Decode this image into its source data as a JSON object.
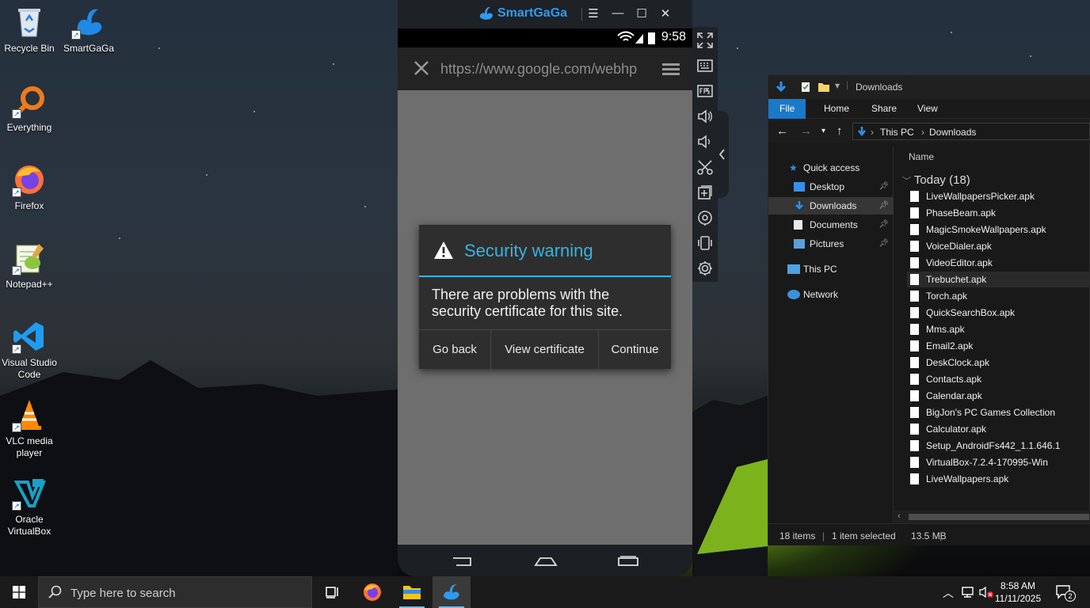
{
  "desktop": {
    "icons": [
      {
        "label": "Recycle Bin",
        "icon": "recycle-bin-icon"
      },
      {
        "label": "SmartGaGa",
        "icon": "smartgaga-icon"
      },
      {
        "label": "Everything",
        "icon": "everything-search-icon"
      },
      {
        "label": "Firefox",
        "icon": "firefox-icon"
      },
      {
        "label": "Notepad++",
        "icon": "notepadpp-icon"
      },
      {
        "label": "Visual Studio Code",
        "icon": "vscode-icon"
      },
      {
        "label": "VLC media player",
        "icon": "vlc-icon"
      },
      {
        "label": "Oracle VirtualBox",
        "icon": "virtualbox-icon"
      }
    ]
  },
  "emulator": {
    "brand": "SmartGaGa",
    "status_time": "9:58",
    "url": "https://www.google.com/webhp",
    "dialog": {
      "title": "Security warning",
      "message": "There are problems with the security certificate for this site.",
      "buttons": [
        "Go back",
        "View certificate",
        "Continue"
      ]
    },
    "toolbar_icons": [
      "fullscreen-icon",
      "keyboard-icon",
      "fps-icon",
      "volume-up-icon",
      "volume-down-icon",
      "screenshot-scissors-icon",
      "add-app-icon",
      "location-icon",
      "shake-icon",
      "settings-icon"
    ]
  },
  "explorer": {
    "title": "Downloads",
    "ribbon_tabs": [
      "File",
      "Home",
      "Share",
      "View"
    ],
    "breadcrumb": [
      "This PC",
      "Downloads"
    ],
    "nav": [
      {
        "label": "Quick access",
        "pinned": false
      },
      {
        "label": "Desktop",
        "pinned": true
      },
      {
        "label": "Downloads",
        "pinned": true
      },
      {
        "label": "Documents",
        "pinned": true
      },
      {
        "label": "Pictures",
        "pinned": true
      },
      {
        "label": "This PC",
        "pinned": false
      },
      {
        "label": "Network",
        "pinned": false
      }
    ],
    "column_header": "Name",
    "group": "Today (18)",
    "files": [
      "LiveWallpapersPicker.apk",
      "PhaseBeam.apk",
      "MagicSmokeWallpapers.apk",
      "VoiceDialer.apk",
      "VideoEditor.apk",
      "Trebuchet.apk",
      "Torch.apk",
      "QuickSearchBox.apk",
      "Mms.apk",
      "Email2.apk",
      "DeskClock.apk",
      "Contacts.apk",
      "Calendar.apk",
      "BigJon's PC Games Collection",
      "Calculator.apk",
      "Setup_AndroidFs442_1.1.646.1",
      "VirtualBox-7.2.4-170995-Win",
      "LiveWallpapers.apk"
    ],
    "selected_index": 5,
    "status_items": "18 items",
    "status_selected": "1 item selected",
    "status_size": "13.5 MB"
  },
  "taskbar": {
    "search_placeholder": "Type here to search",
    "time": "8:58 AM",
    "date": "11/11/2025",
    "notification_count": "2"
  }
}
